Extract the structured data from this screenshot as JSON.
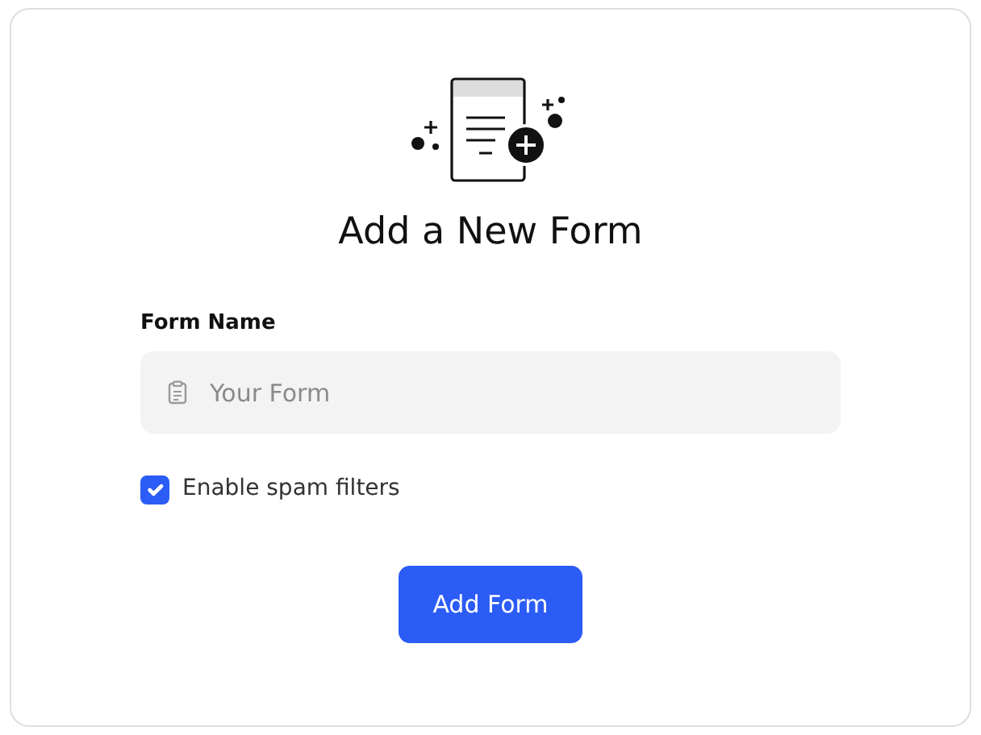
{
  "title": "Add a New Form",
  "form_name": {
    "label": "Form Name",
    "placeholder": "Your Form"
  },
  "spam_filter": {
    "label": "Enable spam filters",
    "checked": true
  },
  "submit": {
    "label": "Add Form"
  }
}
